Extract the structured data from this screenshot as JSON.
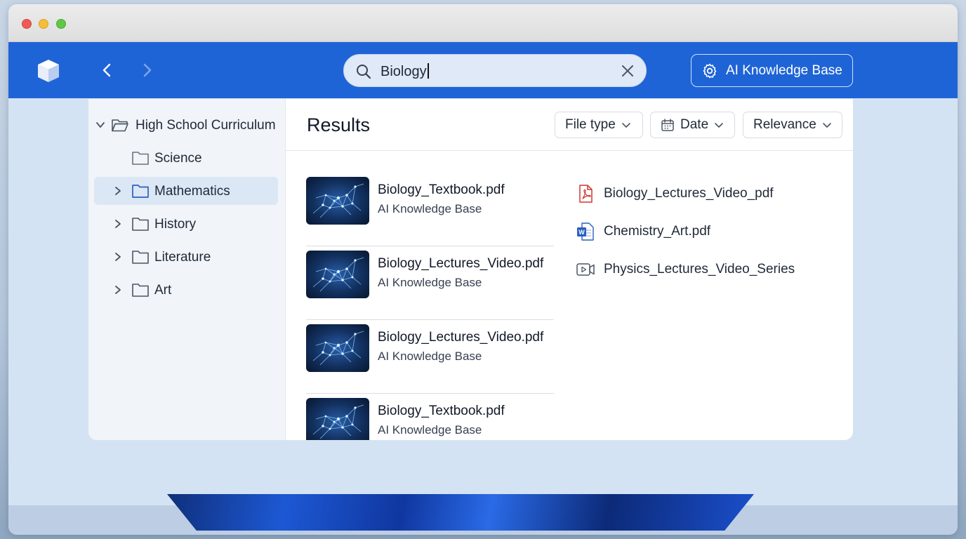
{
  "window": {
    "controls": [
      "close",
      "minimize",
      "zoom"
    ]
  },
  "appbar": {
    "logo_icon": "cube-icon",
    "back_icon": "chevron-left-icon",
    "forward_icon": "chevron-right-icon",
    "search": {
      "value": "Biology",
      "icon": "search-icon",
      "clear_icon": "close-icon"
    },
    "kb_button": {
      "label": "AI Knowledge Base",
      "icon": "gear-icon"
    }
  },
  "sidebar": {
    "root": {
      "label": "High School Curriculum",
      "expanded": true
    },
    "items": [
      {
        "label": "Science",
        "expandable": false,
        "selected": false
      },
      {
        "label": "Mathematics",
        "expandable": true,
        "selected": true
      },
      {
        "label": "History",
        "expandable": true,
        "selected": false
      },
      {
        "label": "Literature",
        "expandable": true,
        "selected": false
      },
      {
        "label": "Art",
        "expandable": true,
        "selected": false
      }
    ]
  },
  "results": {
    "title": "Results",
    "filters": [
      {
        "label": "File type",
        "icon": ""
      },
      {
        "label": "Date",
        "icon": "calendar-icon"
      },
      {
        "label": "Relevance",
        "icon": ""
      }
    ],
    "cards": [
      {
        "title": "Biology_Textbook.pdf",
        "source": "AI Knowledge Base"
      },
      {
        "title": "Biology_Lectures_Video.pdf",
        "source": "AI Knowledge Base"
      },
      {
        "title": "Biology_Lectures_Video.pdf",
        "source": "AI Knowledge Base"
      },
      {
        "title": "Biology_Textbook.pdf",
        "source": "AI Knowledge Base"
      }
    ],
    "files": [
      {
        "label": "Biology_Lectures_Video_pdf",
        "icon": "pdf-icon"
      },
      {
        "label": "Chemistry_Art.pdf",
        "icon": "word-doc-icon"
      },
      {
        "label": "Physics_Lectures_Video_Series",
        "icon": "video-icon"
      }
    ]
  },
  "colors": {
    "accent": "#1f64d6",
    "selected_bg": "#dce7f5",
    "pdf_red": "#d0362f",
    "word_blue": "#2b5fbf"
  }
}
